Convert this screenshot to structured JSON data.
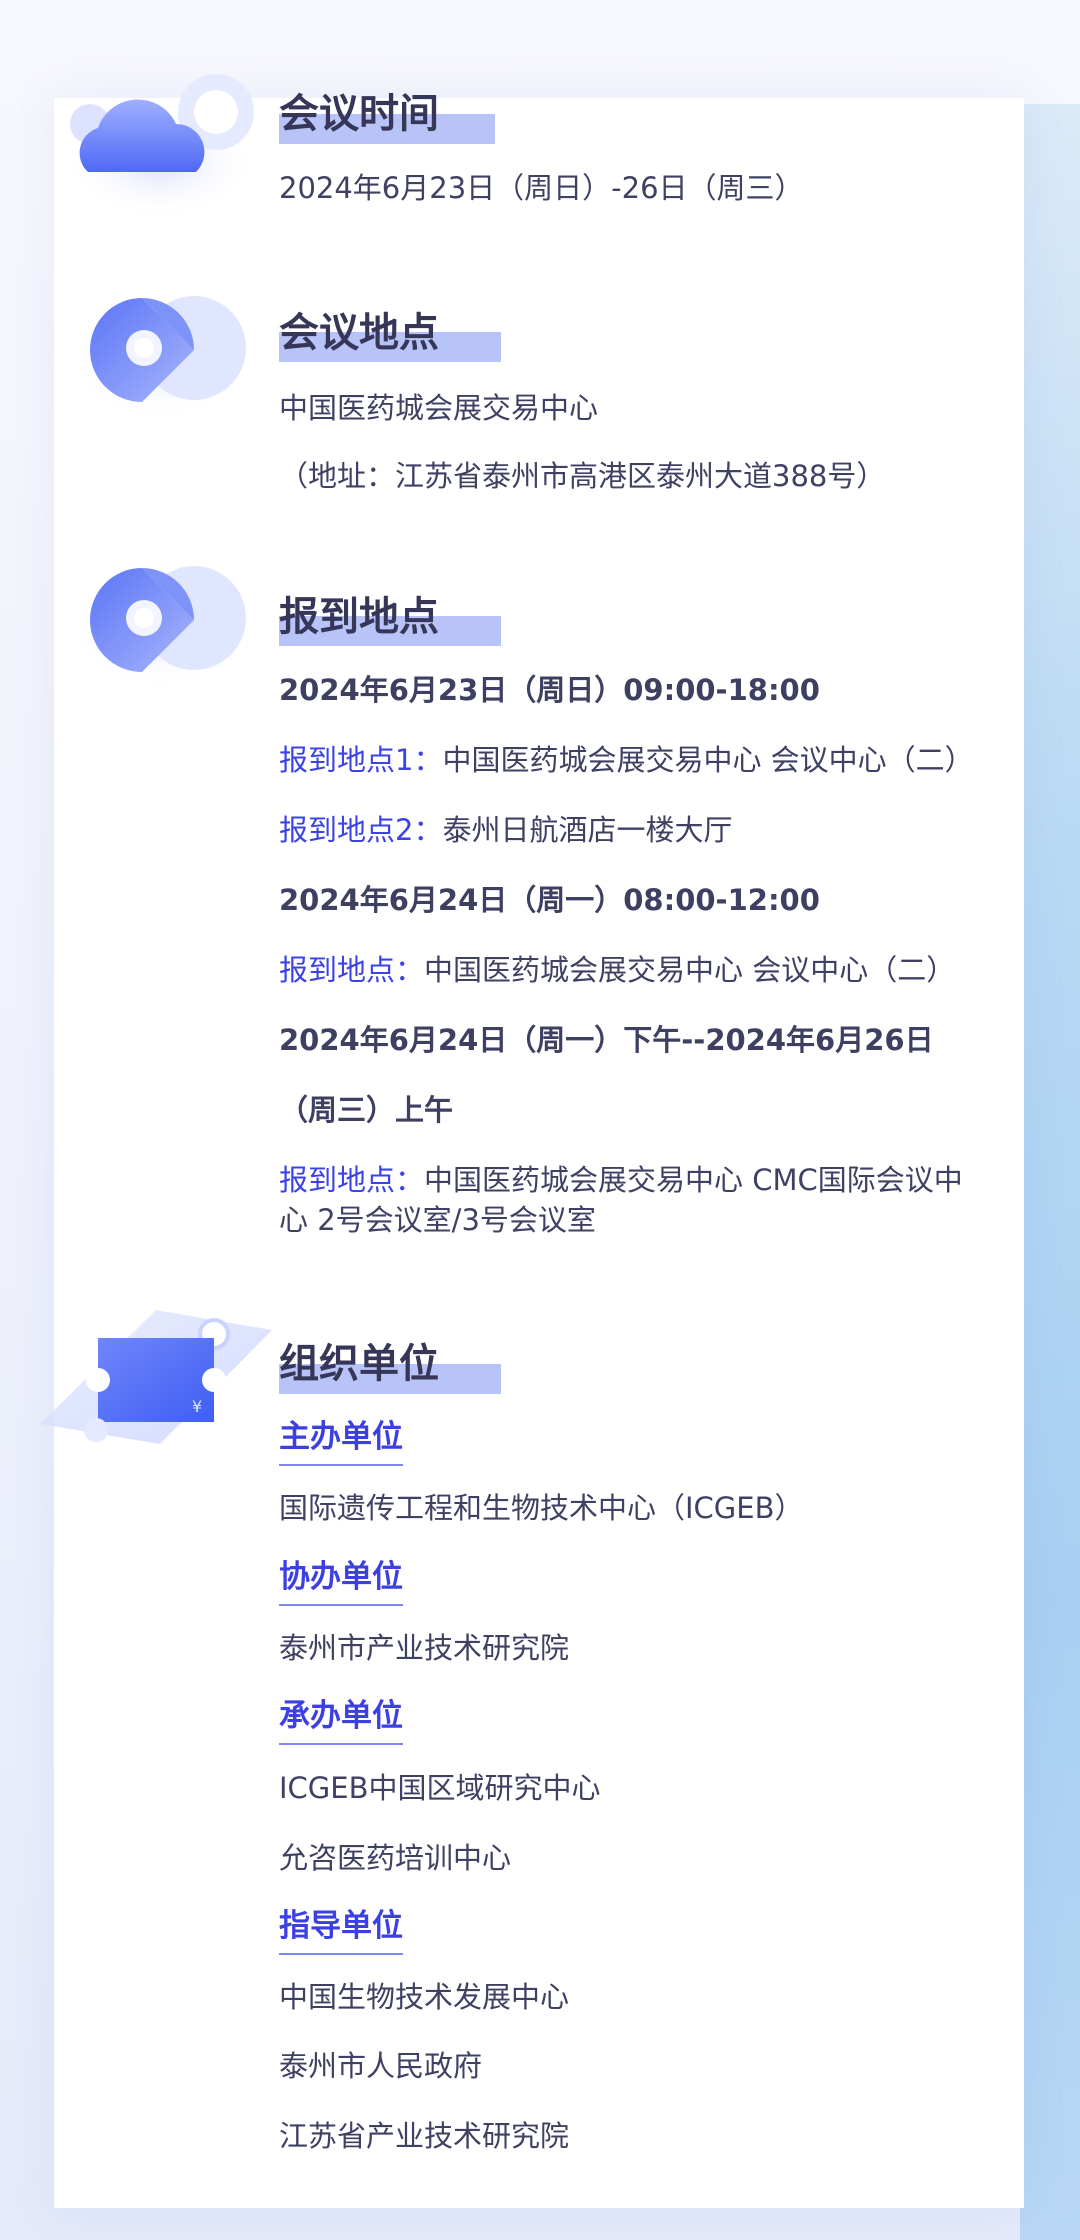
{
  "sections": {
    "time": {
      "icon": "cloud-icon",
      "title": "会议时间",
      "text": "2024年6月23日（周日）-26日（周三）"
    },
    "venue": {
      "icon": "location-pin-icon",
      "title": "会议地点",
      "line1": "中国医药城会展交易中心",
      "line2": "（地址：江苏省泰州市高港区泰州大道388号）"
    },
    "registration": {
      "icon": "location-pin-icon",
      "title": "报到地点",
      "date1": "2024年6月23日（周日）09:00-18:00",
      "loc1_label": "报到地点1：",
      "loc1_text": "中国医药城会展交易中心 会议中心（二）",
      "loc2_label": "报到地点2：",
      "loc2_text": "泰州日航酒店一楼大厅",
      "date2": "2024年6月24日（周一）08:00-12:00",
      "loc3_label": "报到地点：",
      "loc3_text": "中国医药城会展交易中心 会议中心（二）",
      "date3_line1": "2024年6月24日（周一）下午--2024年6月26日",
      "date3_line2": "（周三）上午",
      "loc4_label": "报到地点：",
      "loc4_text": "中国医药城会展交易中心 CMC国际会议中心 2号会议室/3号会议室"
    },
    "organizers": {
      "icon": "ticket-icon",
      "icon_symbol": "¥",
      "title": "组织单位",
      "host_heading": "主办单位",
      "host_1": "国际遗传工程和生物技术中心（ICGEB）",
      "co_heading": "协办单位",
      "co_1": "泰州市产业技术研究院",
      "undertaker_heading": "承办单位",
      "undertaker_1": "ICGEB中国区域研究中心",
      "undertaker_2": "允咨医药培训中心",
      "guide_heading": "指导单位",
      "guide_1": "中国生物技术发展中心",
      "guide_2": "泰州市人民政府",
      "guide_3": "江苏省产业技术研究院"
    }
  },
  "colors": {
    "accent_blue": "#3b42e8",
    "title_bar": "#b8c3f8",
    "text_dark": "#3f4163",
    "side_panel": "#a8d0f2"
  }
}
